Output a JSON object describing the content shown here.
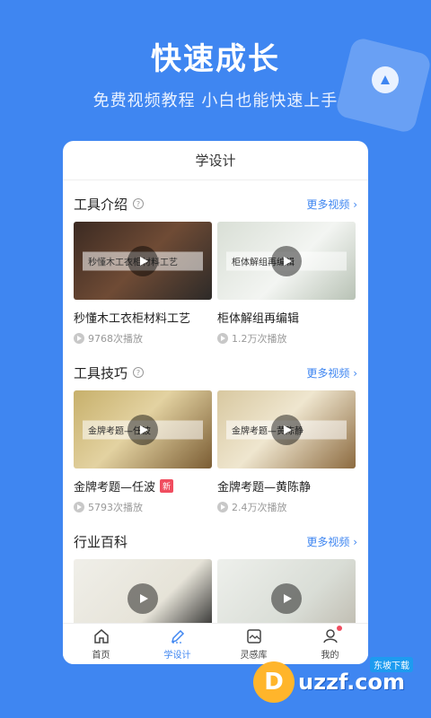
{
  "hero": {
    "title": "快速成长",
    "subtitle": "免费视频教程 小白也能快速上手"
  },
  "header": {
    "title": "学设计"
  },
  "sections": [
    {
      "title": "工具介绍",
      "more": "更多视频 ›",
      "videos": [
        {
          "caption": "秒懂木工衣柜材料工艺",
          "title": "秒懂木工衣柜材料工艺",
          "plays": "9768次播放"
        },
        {
          "caption": "柜体解组再编辑",
          "title": "柜体解组再编辑",
          "plays": "1.2万次播放"
        }
      ]
    },
    {
      "title": "工具技巧",
      "more": "更多视频 ›",
      "videos": [
        {
          "caption": "金牌考题—任波",
          "title": "金牌考题—任波",
          "plays": "5793次播放",
          "badge": "新"
        },
        {
          "caption": "金牌考题—黄陈静",
          "title": "金牌考题—黄陈静",
          "plays": "2.4万次播放"
        }
      ]
    },
    {
      "title": "行业百科",
      "more": "更多视频 ›"
    }
  ],
  "tabs": [
    {
      "label": "首页",
      "icon": "home-icon"
    },
    {
      "label": "学设计",
      "icon": "pencil-icon"
    },
    {
      "label": "灵感库",
      "icon": "gallery-icon"
    },
    {
      "label": "我的",
      "icon": "user-icon"
    }
  ],
  "watermark": {
    "text": "uzzf.com",
    "sub": "东坡下载",
    "logo": "D"
  },
  "colors": {
    "brand": "#3f86f1",
    "badge": "#f04d5f"
  }
}
